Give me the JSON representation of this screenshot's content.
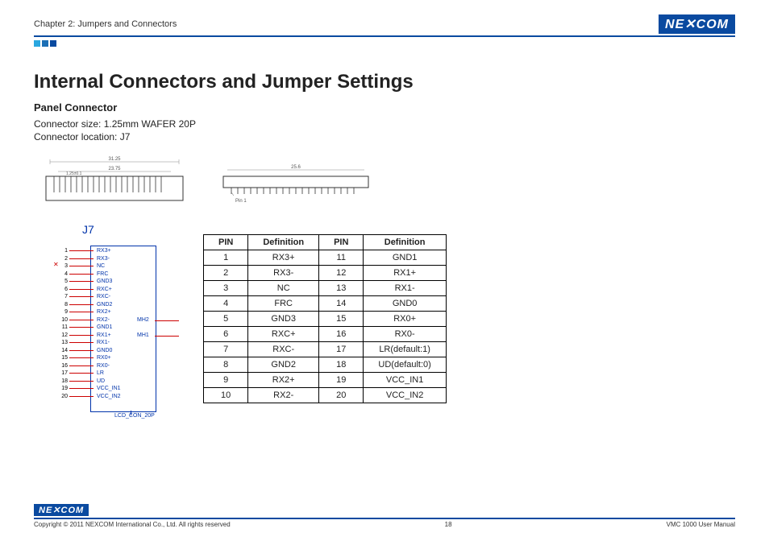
{
  "header": {
    "chapter": "Chapter 2: Jumpers and Connectors",
    "logo": "NE COM"
  },
  "title": "Internal Connectors and Jumper Settings",
  "section": {
    "subhead": "Panel Connector",
    "size_line": "Connector size: 1.25mm WAFER 20P",
    "loc_line": "Connector location: J7"
  },
  "diagram": {
    "top_dim": "31.25",
    "mid_dim": "23.75",
    "pitch": "1.25±0.1",
    "side_dim": "25.6",
    "pin1": "Pin 1"
  },
  "pinout": {
    "title": "J7",
    "mh2": "MH2",
    "mh1": "MH1",
    "footer": "LCD_CON_20P",
    "pins": [
      {
        "n": "1",
        "label": "RX3+"
      },
      {
        "n": "2",
        "label": "RX3-"
      },
      {
        "n": "3",
        "label": "NC"
      },
      {
        "n": "4",
        "label": "FRC"
      },
      {
        "n": "5",
        "label": "GND3"
      },
      {
        "n": "6",
        "label": "RXC+"
      },
      {
        "n": "7",
        "label": "RXC-"
      },
      {
        "n": "8",
        "label": "GND2"
      },
      {
        "n": "9",
        "label": "RX2+"
      },
      {
        "n": "10",
        "label": "RX2-"
      },
      {
        "n": "11",
        "label": "GND1"
      },
      {
        "n": "12",
        "label": "RX1+"
      },
      {
        "n": "13",
        "label": "RX1-"
      },
      {
        "n": "14",
        "label": "GND0"
      },
      {
        "n": "15",
        "label": "RX0+"
      },
      {
        "n": "16",
        "label": "RX0-"
      },
      {
        "n": "17",
        "label": "LR"
      },
      {
        "n": "18",
        "label": "UD"
      },
      {
        "n": "19",
        "label": "VCC_IN1"
      },
      {
        "n": "20",
        "label": "VCC_IN2"
      }
    ]
  },
  "table": {
    "headers": [
      "PIN",
      "Definition",
      "PIN",
      "Definition"
    ],
    "rows": [
      [
        "1",
        "RX3+",
        "11",
        "GND1"
      ],
      [
        "2",
        "RX3-",
        "12",
        "RX1+"
      ],
      [
        "3",
        "NC",
        "13",
        "RX1-"
      ],
      [
        "4",
        "FRC",
        "14",
        "GND0"
      ],
      [
        "5",
        "GND3",
        "15",
        "RX0+"
      ],
      [
        "6",
        "RXC+",
        "16",
        "RX0-"
      ],
      [
        "7",
        "RXC-",
        "17",
        "LR(default:1)"
      ],
      [
        "8",
        "GND2",
        "18",
        "UD(default:0)"
      ],
      [
        "9",
        "RX2+",
        "19",
        "VCC_IN1"
      ],
      [
        "10",
        "RX2-",
        "20",
        "VCC_IN2"
      ]
    ]
  },
  "footer": {
    "copyright": "Copyright © 2011 NEXCOM International Co., Ltd. All rights reserved",
    "page": "18",
    "manual": "VMC 1000 User Manual"
  }
}
